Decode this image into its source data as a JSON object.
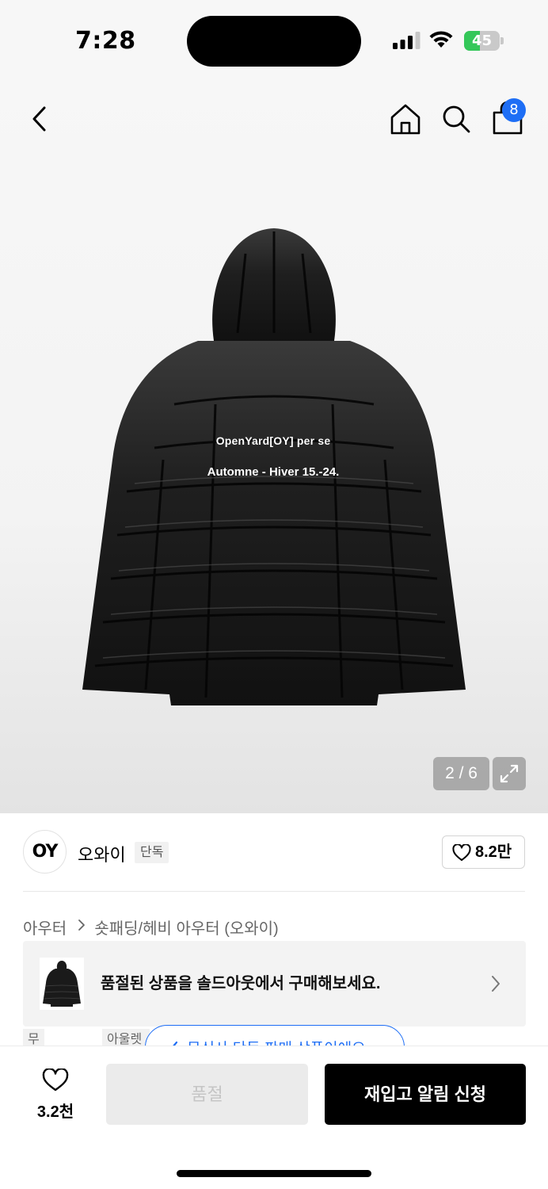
{
  "status_bar": {
    "time": "7:28",
    "battery_level": "45",
    "battery_fraction": 0.45,
    "icons": [
      "cellular-signal-icon",
      "wifi-icon",
      "battery-charging-icon"
    ]
  },
  "top_nav": {
    "icons": [
      "back-chevron-icon",
      "home-icon",
      "search-icon",
      "shopping-bag-icon"
    ],
    "cart_count": "8"
  },
  "product_image": {
    "print_line1": "OpenYard[OY] per se",
    "print_line2": "Automne - Hiver 15.-24.",
    "pager": "2 / 6"
  },
  "brand": {
    "logo_text": "OY",
    "name": "오와이",
    "tag": "단독",
    "like_count": "8.2만"
  },
  "breadcrumb": {
    "category": "아우터",
    "subcategory": "숏패딩/헤비 아우터 (오와이)"
  },
  "soldout_banner": {
    "text": "품절된 상품을 솔드아웃에서 구매해보세요."
  },
  "tags": [
    "무신사단독",
    "아울렛"
  ],
  "exclusive_notice": "무신사 단독 판매 상품이에요",
  "bottom_bar": {
    "wish_count": "3.2천",
    "soldout_label": "품절",
    "restock_label": "재입고 알림 신청"
  },
  "colors": {
    "accent_blue": "#1e6ef5",
    "battery_green": "#34c759",
    "primary_button": "#000000",
    "disabled_button": "#ebebeb"
  }
}
